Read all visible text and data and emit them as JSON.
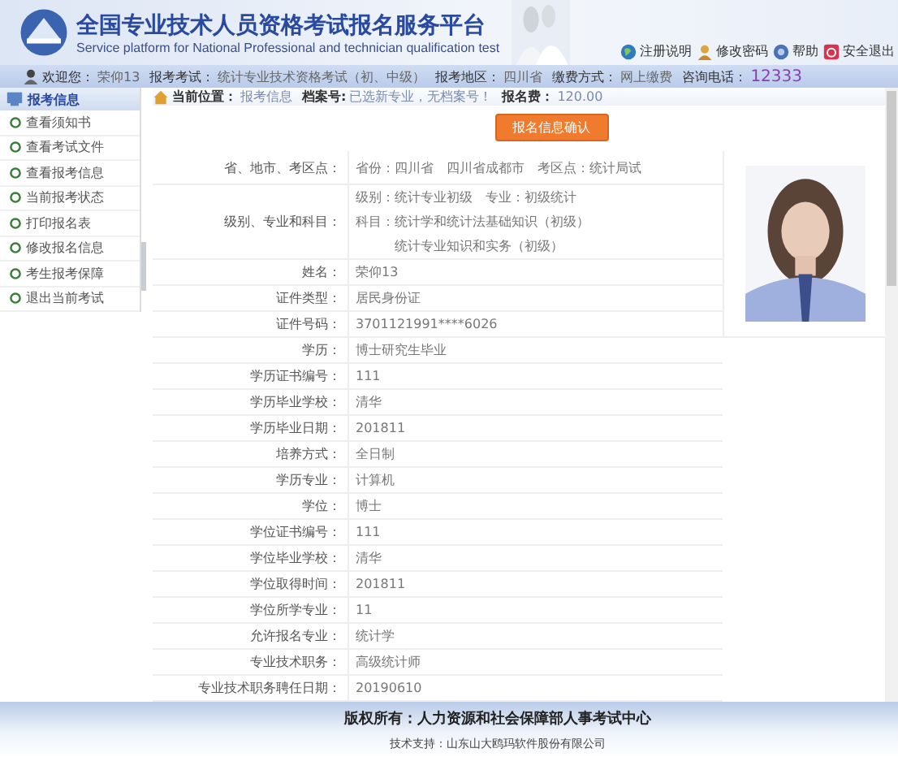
{
  "header": {
    "title": "全国专业技术人员资格考试报名服务平台",
    "subtitle": "Service platform for National Professional and technician qualification test",
    "links": [
      {
        "kind": "globe",
        "label": "注册说明"
      },
      {
        "kind": "person",
        "label": "修改密码"
      },
      {
        "kind": "help",
        "label": "帮助"
      },
      {
        "kind": "exit",
        "label": "安全退出"
      }
    ]
  },
  "info_bar": [
    {
      "label": "欢迎您：",
      "value": "荣仰13",
      "highlight": false
    },
    {
      "label": "报考考试：",
      "value": "统计专业技术资格考试（初、中级）",
      "highlight": false
    },
    {
      "label": "报考地区：",
      "value": "四川省",
      "highlight": false
    },
    {
      "label": "缴费方式：",
      "value": "网上缴费",
      "highlight": false
    },
    {
      "label": "咨询电话：",
      "value": "12333",
      "highlight": true
    }
  ],
  "sidebar": {
    "title": "报考信息",
    "items": [
      {
        "label": "查看须知书"
      },
      {
        "label": "查看考试文件"
      },
      {
        "label": "查看报考信息"
      },
      {
        "label": "当前报考状态"
      },
      {
        "label": "打印报名表"
      },
      {
        "label": "修改报名信息"
      },
      {
        "label": "考生报考保障"
      },
      {
        "label": "退出当前考试"
      }
    ]
  },
  "breadcrumb": [
    {
      "label": "当前位置：",
      "value": "报考信息"
    },
    {
      "label": "档案号:",
      "value": "已选新专业，无档案号！"
    },
    {
      "label": "报名费：",
      "value": "120.00"
    }
  ],
  "confirm_button": "报名信息确认",
  "form": [
    {
      "label": "省、地市、考区点：",
      "lines": [
        "省份：四川省　四川省成都市　考区点：统计局试"
      ]
    },
    {
      "label": "级别、专业和科目：",
      "lines": [
        "级别：统计专业初级　专业：初级统计",
        "科目：统计学和统计法基础知识（初级）",
        "　　　统计专业知识和实务（初级）"
      ]
    },
    {
      "label": "姓名：",
      "lines": [
        "荣仰13"
      ]
    },
    {
      "label": "证件类型：",
      "lines": [
        "居民身份证"
      ]
    },
    {
      "label": "证件号码：",
      "lines": [
        "3701121991****6026"
      ]
    },
    {
      "label": "学历：",
      "lines": [
        "博士研究生毕业"
      ]
    },
    {
      "label": "学历证书编号：",
      "lines": [
        "111"
      ]
    },
    {
      "label": "学历毕业学校：",
      "lines": [
        "清华"
      ]
    },
    {
      "label": "学历毕业日期：",
      "lines": [
        "201811"
      ]
    },
    {
      "label": "培养方式：",
      "lines": [
        "全日制"
      ]
    },
    {
      "label": "学历专业：",
      "lines": [
        "计算机"
      ]
    },
    {
      "label": "学位：",
      "lines": [
        "博士"
      ]
    },
    {
      "label": "学位证书编号：",
      "lines": [
        "111"
      ]
    },
    {
      "label": "学位毕业学校：",
      "lines": [
        "清华"
      ]
    },
    {
      "label": "学位取得时间：",
      "lines": [
        "201811"
      ]
    },
    {
      "label": "学位所学专业：",
      "lines": [
        "11"
      ]
    },
    {
      "label": "允许报名专业：",
      "lines": [
        "统计学"
      ]
    },
    {
      "label": "专业技术职务：",
      "lines": [
        "高级统计师"
      ]
    },
    {
      "label": "专业技术职务聘任日期：",
      "lines": [
        "20190610"
      ]
    }
  ],
  "footer": {
    "copyright": "版权所有：人力资源和社会保障部人事考试中心",
    "support": "技术支持：山东山大鸥玛软件股份有限公司"
  }
}
